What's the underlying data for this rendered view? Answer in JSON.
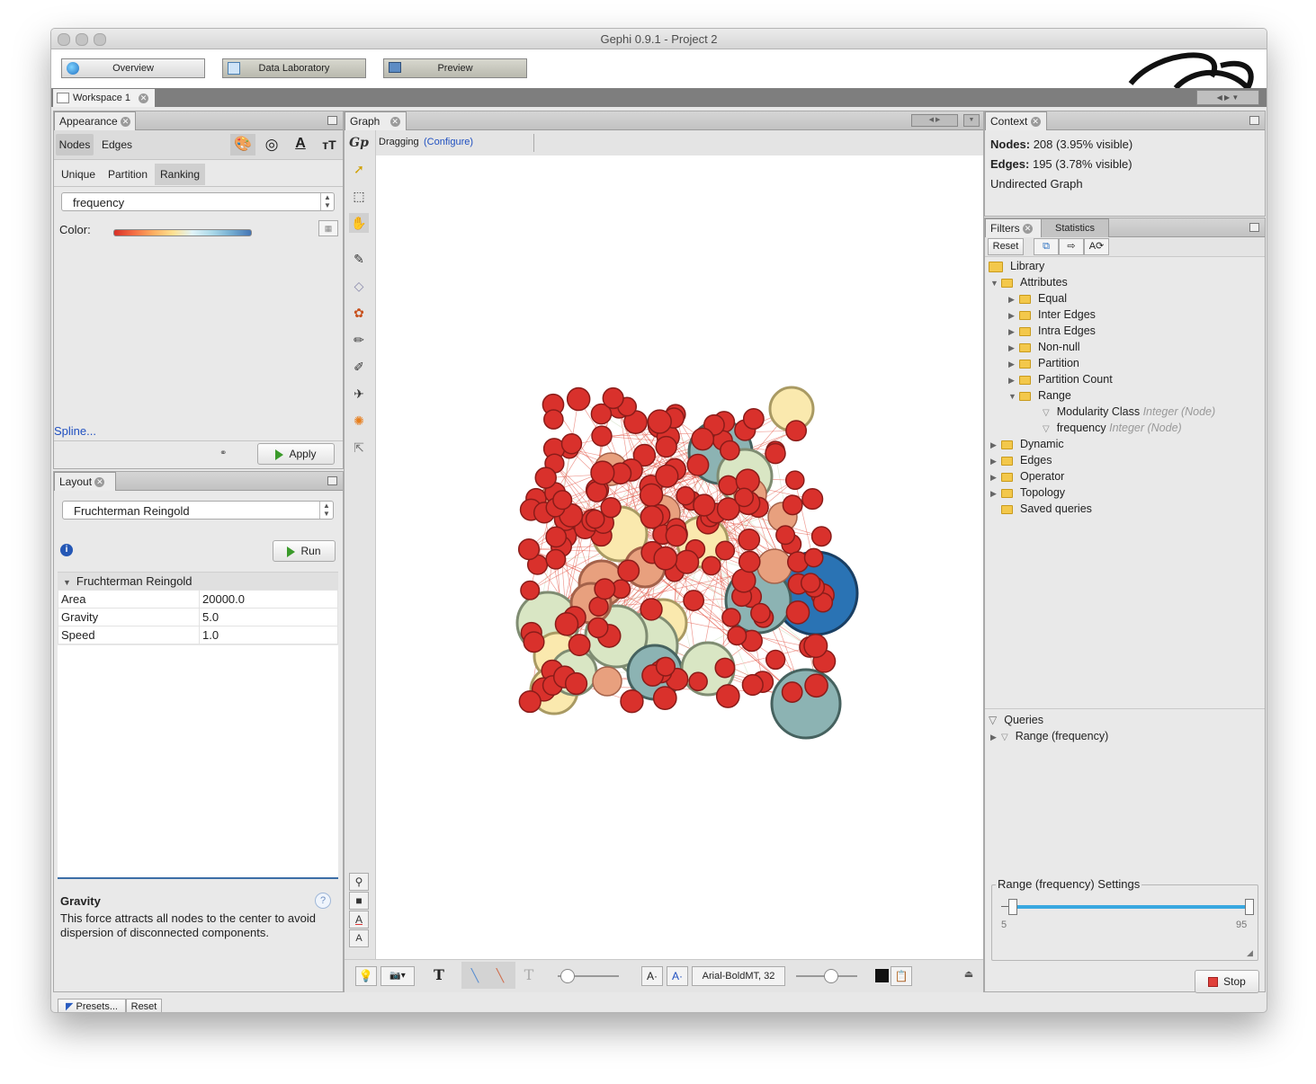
{
  "window": {
    "title": "Gephi 0.9.1 - Project 2"
  },
  "topbar": {
    "overview": "Overview",
    "data_lab": "Data Laboratory",
    "preview": "Preview"
  },
  "workspace": {
    "tab": "Workspace 1"
  },
  "appearance": {
    "tab": "Appearance",
    "nodes": "Nodes",
    "edges": "Edges",
    "subtabs": [
      "Unique",
      "Partition",
      "Ranking"
    ],
    "attribute": "frequency",
    "color_label": "Color:",
    "spline": "Spline...",
    "apply": "Apply"
  },
  "layout": {
    "tab": "Layout",
    "algorithm": "Fruchterman Reingold",
    "run": "Run",
    "section": "Fruchterman Reingold",
    "props": [
      {
        "name": "Area",
        "value": "20000.0"
      },
      {
        "name": "Gravity",
        "value": "5.0"
      },
      {
        "name": "Speed",
        "value": "1.0"
      }
    ],
    "desc_title": "Gravity",
    "desc_text": "This force attracts all nodes to the center to avoid dispersion of disconnected components.",
    "presets": "Presets...",
    "reset": "Reset"
  },
  "graph": {
    "tab": "Graph",
    "mode": "Dragging",
    "configure": "(Configure)",
    "font": "Arial-BoldMT, 32",
    "palette": {
      "red": "#d9312c",
      "salmon": "#e8a07e",
      "cream": "#fae9ae",
      "sage": "#d9e6c4",
      "teal": "#8cb3b3",
      "blue": "#2a73b4"
    }
  },
  "context": {
    "tab": "Context",
    "nodes_label": "Nodes:",
    "nodes_value": "208 (3.95% visible)",
    "edges_label": "Edges:",
    "edges_value": "195 (3.78% visible)",
    "graph_type": "Undirected Graph"
  },
  "filters": {
    "tab": "Filters",
    "stats_tab": "Statistics",
    "reset": "Reset",
    "library": "Library",
    "attributes": "Attributes",
    "attr_items": [
      "Equal",
      "Inter Edges",
      "Intra Edges",
      "Non-null",
      "Partition",
      "Partition Count",
      "Range"
    ],
    "range_items": [
      {
        "name": "Modularity Class",
        "type": "Integer (Node)"
      },
      {
        "name": "frequency",
        "type": "Integer (Node)"
      }
    ],
    "top_items": [
      "Dynamic",
      "Edges",
      "Operator",
      "Topology",
      "Saved queries"
    ],
    "queries": "Queries",
    "query_item": "Range (frequency)",
    "settings_title": "Range (frequency) Settings",
    "range_min": "5",
    "range_max": "95",
    "stop": "Stop"
  }
}
